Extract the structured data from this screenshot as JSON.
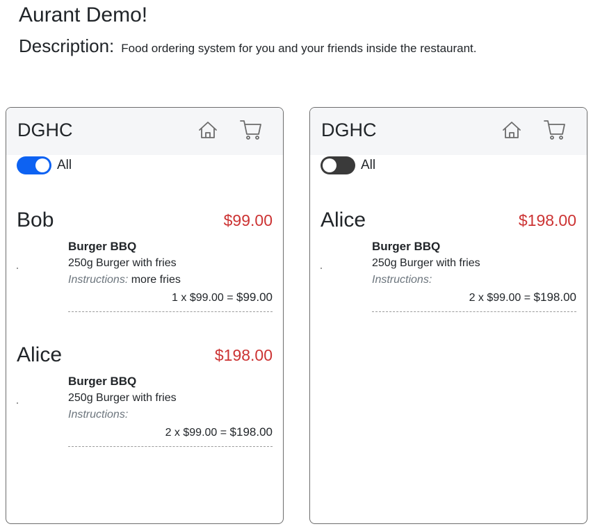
{
  "app": {
    "title": "Aurant Demo!",
    "description_label": "Description:",
    "description_text": "Food ordering system for you and your friends inside the restaurant."
  },
  "colors": {
    "toggle_on": "#0d62f2",
    "toggle_off": "#3a3a3a",
    "price_red": "#cc3333"
  },
  "phones": [
    {
      "brand": "DGHC",
      "home_icon": "home-icon",
      "cart_icon": "cart-icon",
      "toggle": {
        "label": "All",
        "on": true
      },
      "people": [
        {
          "name": "Bob",
          "total": "$99.00",
          "items": [
            {
              "title": "Burger BBQ",
              "desc": "250g Burger with fries",
              "instr_label": "Instructions:",
              "instr_value": "more fries",
              "calc_prefix": "1 x $99.00 = ",
              "calc_total": "$99.00"
            }
          ]
        },
        {
          "name": "Alice",
          "total": "$198.00",
          "items": [
            {
              "title": "Burger BBQ",
              "desc": "250g Burger with fries",
              "instr_label": "Instructions:",
              "instr_value": "",
              "calc_prefix": "2 x $99.00 = ",
              "calc_total": "$198.00"
            }
          ]
        }
      ]
    },
    {
      "brand": "DGHC",
      "home_icon": "home-icon",
      "cart_icon": "cart-icon",
      "toggle": {
        "label": "All",
        "on": false
      },
      "people": [
        {
          "name": "Alice",
          "total": "$198.00",
          "items": [
            {
              "title": "Burger BBQ",
              "desc": "250g Burger with fries",
              "instr_label": "Instructions:",
              "instr_value": "",
              "calc_prefix": "2 x $99.00 = ",
              "calc_total": "$198.00"
            }
          ]
        }
      ]
    }
  ]
}
